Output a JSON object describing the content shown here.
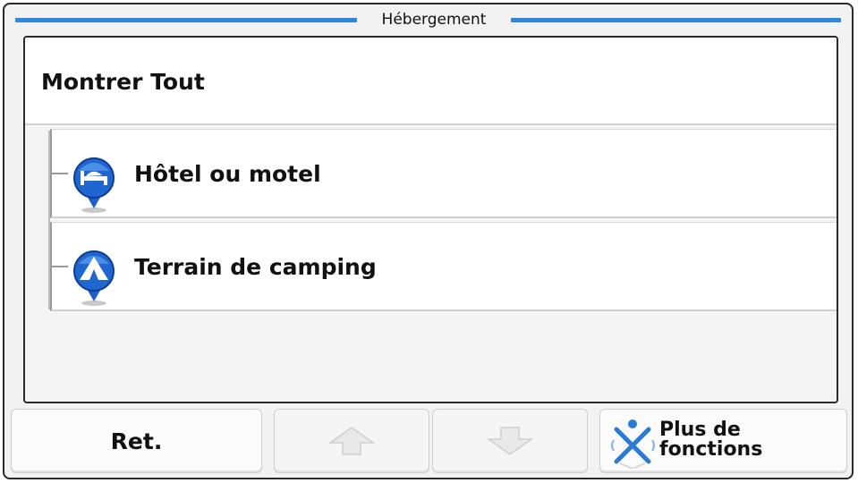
{
  "window": {
    "title": "Hébergement",
    "accent_color": "#2f86e0"
  },
  "list": {
    "show_all_label": "Montrer Tout",
    "items": [
      {
        "label": "Hôtel ou motel",
        "icon": "hotel-bed-icon"
      },
      {
        "label": "Terrain de camping",
        "icon": "camping-tent-icon"
      }
    ]
  },
  "buttons": {
    "back_label": "Ret.",
    "scroll_up_icon": "arrow-up-icon",
    "scroll_down_icon": "arrow-down-icon",
    "more_label": "Plus de\nfonctions",
    "more_icon": "more-functions-icon"
  }
}
